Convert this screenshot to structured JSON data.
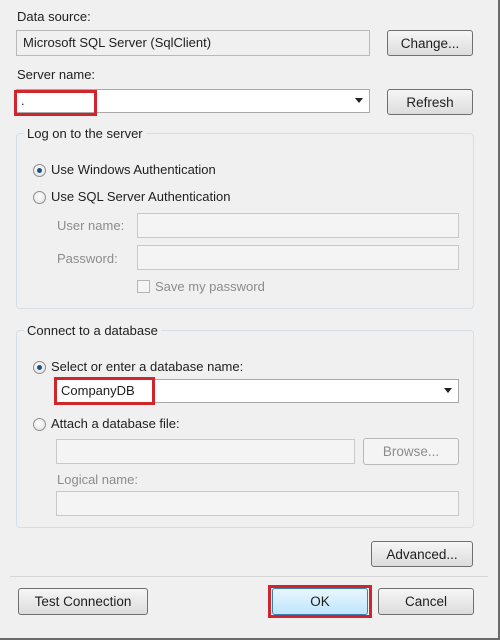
{
  "data_source": {
    "label": "Data source:",
    "value": "Microsoft SQL Server (SqlClient)",
    "change_button": "Change..."
  },
  "server": {
    "label": "Server name:",
    "value": ".",
    "refresh_button": "Refresh"
  },
  "logon": {
    "title": "Log on to the server",
    "windows_auth": "Use Windows Authentication",
    "sql_auth": "Use SQL Server Authentication",
    "user_name_label": "User name:",
    "password_label": "Password:",
    "save_password": "Save my password"
  },
  "database": {
    "title": "Connect to a database",
    "select_option": "Select or enter a database name:",
    "selected_db": "CompanyDB",
    "attach_option": "Attach a database file:",
    "browse_button": "Browse...",
    "logical_name_label": "Logical name:"
  },
  "advanced_button": "Advanced...",
  "footer": {
    "test_connection": "Test Connection",
    "ok": "OK",
    "cancel": "Cancel"
  },
  "colors": {
    "highlight": "#d0262b",
    "dialog_bg": "#f0f0f0",
    "radio_dot": "#1f4f8a"
  }
}
